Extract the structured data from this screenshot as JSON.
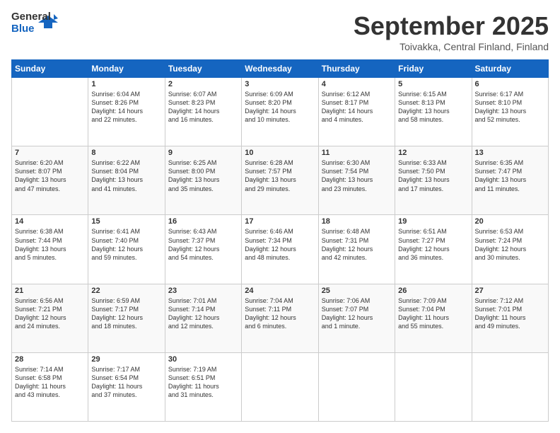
{
  "header": {
    "logo_general": "General",
    "logo_blue": "Blue",
    "title": "September 2025",
    "location": "Toivakka, Central Finland, Finland"
  },
  "days_of_week": [
    "Sunday",
    "Monday",
    "Tuesday",
    "Wednesday",
    "Thursday",
    "Friday",
    "Saturday"
  ],
  "weeks": [
    [
      {
        "day": "",
        "lines": []
      },
      {
        "day": "1",
        "lines": [
          "Sunrise: 6:04 AM",
          "Sunset: 8:26 PM",
          "Daylight: 14 hours",
          "and 22 minutes."
        ]
      },
      {
        "day": "2",
        "lines": [
          "Sunrise: 6:07 AM",
          "Sunset: 8:23 PM",
          "Daylight: 14 hours",
          "and 16 minutes."
        ]
      },
      {
        "day": "3",
        "lines": [
          "Sunrise: 6:09 AM",
          "Sunset: 8:20 PM",
          "Daylight: 14 hours",
          "and 10 minutes."
        ]
      },
      {
        "day": "4",
        "lines": [
          "Sunrise: 6:12 AM",
          "Sunset: 8:17 PM",
          "Daylight: 14 hours",
          "and 4 minutes."
        ]
      },
      {
        "day": "5",
        "lines": [
          "Sunrise: 6:15 AM",
          "Sunset: 8:13 PM",
          "Daylight: 13 hours",
          "and 58 minutes."
        ]
      },
      {
        "day": "6",
        "lines": [
          "Sunrise: 6:17 AM",
          "Sunset: 8:10 PM",
          "Daylight: 13 hours",
          "and 52 minutes."
        ]
      }
    ],
    [
      {
        "day": "7",
        "lines": [
          "Sunrise: 6:20 AM",
          "Sunset: 8:07 PM",
          "Daylight: 13 hours",
          "and 47 minutes."
        ]
      },
      {
        "day": "8",
        "lines": [
          "Sunrise: 6:22 AM",
          "Sunset: 8:04 PM",
          "Daylight: 13 hours",
          "and 41 minutes."
        ]
      },
      {
        "day": "9",
        "lines": [
          "Sunrise: 6:25 AM",
          "Sunset: 8:00 PM",
          "Daylight: 13 hours",
          "and 35 minutes."
        ]
      },
      {
        "day": "10",
        "lines": [
          "Sunrise: 6:28 AM",
          "Sunset: 7:57 PM",
          "Daylight: 13 hours",
          "and 29 minutes."
        ]
      },
      {
        "day": "11",
        "lines": [
          "Sunrise: 6:30 AM",
          "Sunset: 7:54 PM",
          "Daylight: 13 hours",
          "and 23 minutes."
        ]
      },
      {
        "day": "12",
        "lines": [
          "Sunrise: 6:33 AM",
          "Sunset: 7:50 PM",
          "Daylight: 13 hours",
          "and 17 minutes."
        ]
      },
      {
        "day": "13",
        "lines": [
          "Sunrise: 6:35 AM",
          "Sunset: 7:47 PM",
          "Daylight: 13 hours",
          "and 11 minutes."
        ]
      }
    ],
    [
      {
        "day": "14",
        "lines": [
          "Sunrise: 6:38 AM",
          "Sunset: 7:44 PM",
          "Daylight: 13 hours",
          "and 5 minutes."
        ]
      },
      {
        "day": "15",
        "lines": [
          "Sunrise: 6:41 AM",
          "Sunset: 7:40 PM",
          "Daylight: 12 hours",
          "and 59 minutes."
        ]
      },
      {
        "day": "16",
        "lines": [
          "Sunrise: 6:43 AM",
          "Sunset: 7:37 PM",
          "Daylight: 12 hours",
          "and 54 minutes."
        ]
      },
      {
        "day": "17",
        "lines": [
          "Sunrise: 6:46 AM",
          "Sunset: 7:34 PM",
          "Daylight: 12 hours",
          "and 48 minutes."
        ]
      },
      {
        "day": "18",
        "lines": [
          "Sunrise: 6:48 AM",
          "Sunset: 7:31 PM",
          "Daylight: 12 hours",
          "and 42 minutes."
        ]
      },
      {
        "day": "19",
        "lines": [
          "Sunrise: 6:51 AM",
          "Sunset: 7:27 PM",
          "Daylight: 12 hours",
          "and 36 minutes."
        ]
      },
      {
        "day": "20",
        "lines": [
          "Sunrise: 6:53 AM",
          "Sunset: 7:24 PM",
          "Daylight: 12 hours",
          "and 30 minutes."
        ]
      }
    ],
    [
      {
        "day": "21",
        "lines": [
          "Sunrise: 6:56 AM",
          "Sunset: 7:21 PM",
          "Daylight: 12 hours",
          "and 24 minutes."
        ]
      },
      {
        "day": "22",
        "lines": [
          "Sunrise: 6:59 AM",
          "Sunset: 7:17 PM",
          "Daylight: 12 hours",
          "and 18 minutes."
        ]
      },
      {
        "day": "23",
        "lines": [
          "Sunrise: 7:01 AM",
          "Sunset: 7:14 PM",
          "Daylight: 12 hours",
          "and 12 minutes."
        ]
      },
      {
        "day": "24",
        "lines": [
          "Sunrise: 7:04 AM",
          "Sunset: 7:11 PM",
          "Daylight: 12 hours",
          "and 6 minutes."
        ]
      },
      {
        "day": "25",
        "lines": [
          "Sunrise: 7:06 AM",
          "Sunset: 7:07 PM",
          "Daylight: 12 hours",
          "and 1 minute."
        ]
      },
      {
        "day": "26",
        "lines": [
          "Sunrise: 7:09 AM",
          "Sunset: 7:04 PM",
          "Daylight: 11 hours",
          "and 55 minutes."
        ]
      },
      {
        "day": "27",
        "lines": [
          "Sunrise: 7:12 AM",
          "Sunset: 7:01 PM",
          "Daylight: 11 hours",
          "and 49 minutes."
        ]
      }
    ],
    [
      {
        "day": "28",
        "lines": [
          "Sunrise: 7:14 AM",
          "Sunset: 6:58 PM",
          "Daylight: 11 hours",
          "and 43 minutes."
        ]
      },
      {
        "day": "29",
        "lines": [
          "Sunrise: 7:17 AM",
          "Sunset: 6:54 PM",
          "Daylight: 11 hours",
          "and 37 minutes."
        ]
      },
      {
        "day": "30",
        "lines": [
          "Sunrise: 7:19 AM",
          "Sunset: 6:51 PM",
          "Daylight: 11 hours",
          "and 31 minutes."
        ]
      },
      {
        "day": "",
        "lines": []
      },
      {
        "day": "",
        "lines": []
      },
      {
        "day": "",
        "lines": []
      },
      {
        "day": "",
        "lines": []
      }
    ]
  ]
}
